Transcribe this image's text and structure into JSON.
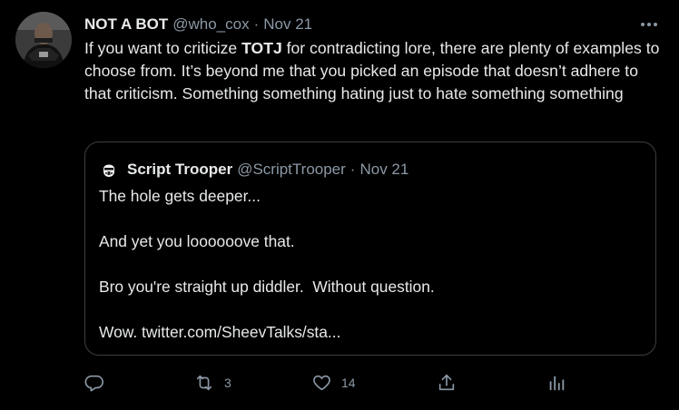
{
  "tweet": {
    "author": {
      "display_name": "NOT A BOT",
      "handle": "@who_cox",
      "separator": "·",
      "date": "Nov 21"
    },
    "more_icon": "more-horizontal-icon",
    "text": {
      "part1": "If you want to criticize ",
      "bold": "TOTJ",
      "part2": " for contradicting lore, there are plenty of examples to choose from. It’s beyond me that you picked an episode that doesn’t adhere to that criticism. Something something hating just to hate something something"
    },
    "quote": {
      "author": {
        "display_name": "Script Trooper",
        "handle": "@ScriptTrooper",
        "separator": "·",
        "date": "Nov 21"
      },
      "lines": [
        "The hole gets deeper...",
        "And yet you loooooove that.",
        "Bro you're straight up diddler.  Without question.",
        "Wow. twitter.com/SheevTalks/sta..."
      ]
    },
    "actions": {
      "reply": {
        "icon": "reply-icon",
        "count": ""
      },
      "retweet": {
        "icon": "retweet-icon",
        "count": "3"
      },
      "like": {
        "icon": "heart-icon",
        "count": "14"
      },
      "share": {
        "icon": "share-icon",
        "count": ""
      },
      "analytics": {
        "icon": "analytics-icon",
        "count": ""
      }
    },
    "colors": {
      "background": "#000000",
      "primary_text": "#e7e9ea",
      "secondary_text": "#8b98a5",
      "border": "#3a3f44"
    }
  }
}
